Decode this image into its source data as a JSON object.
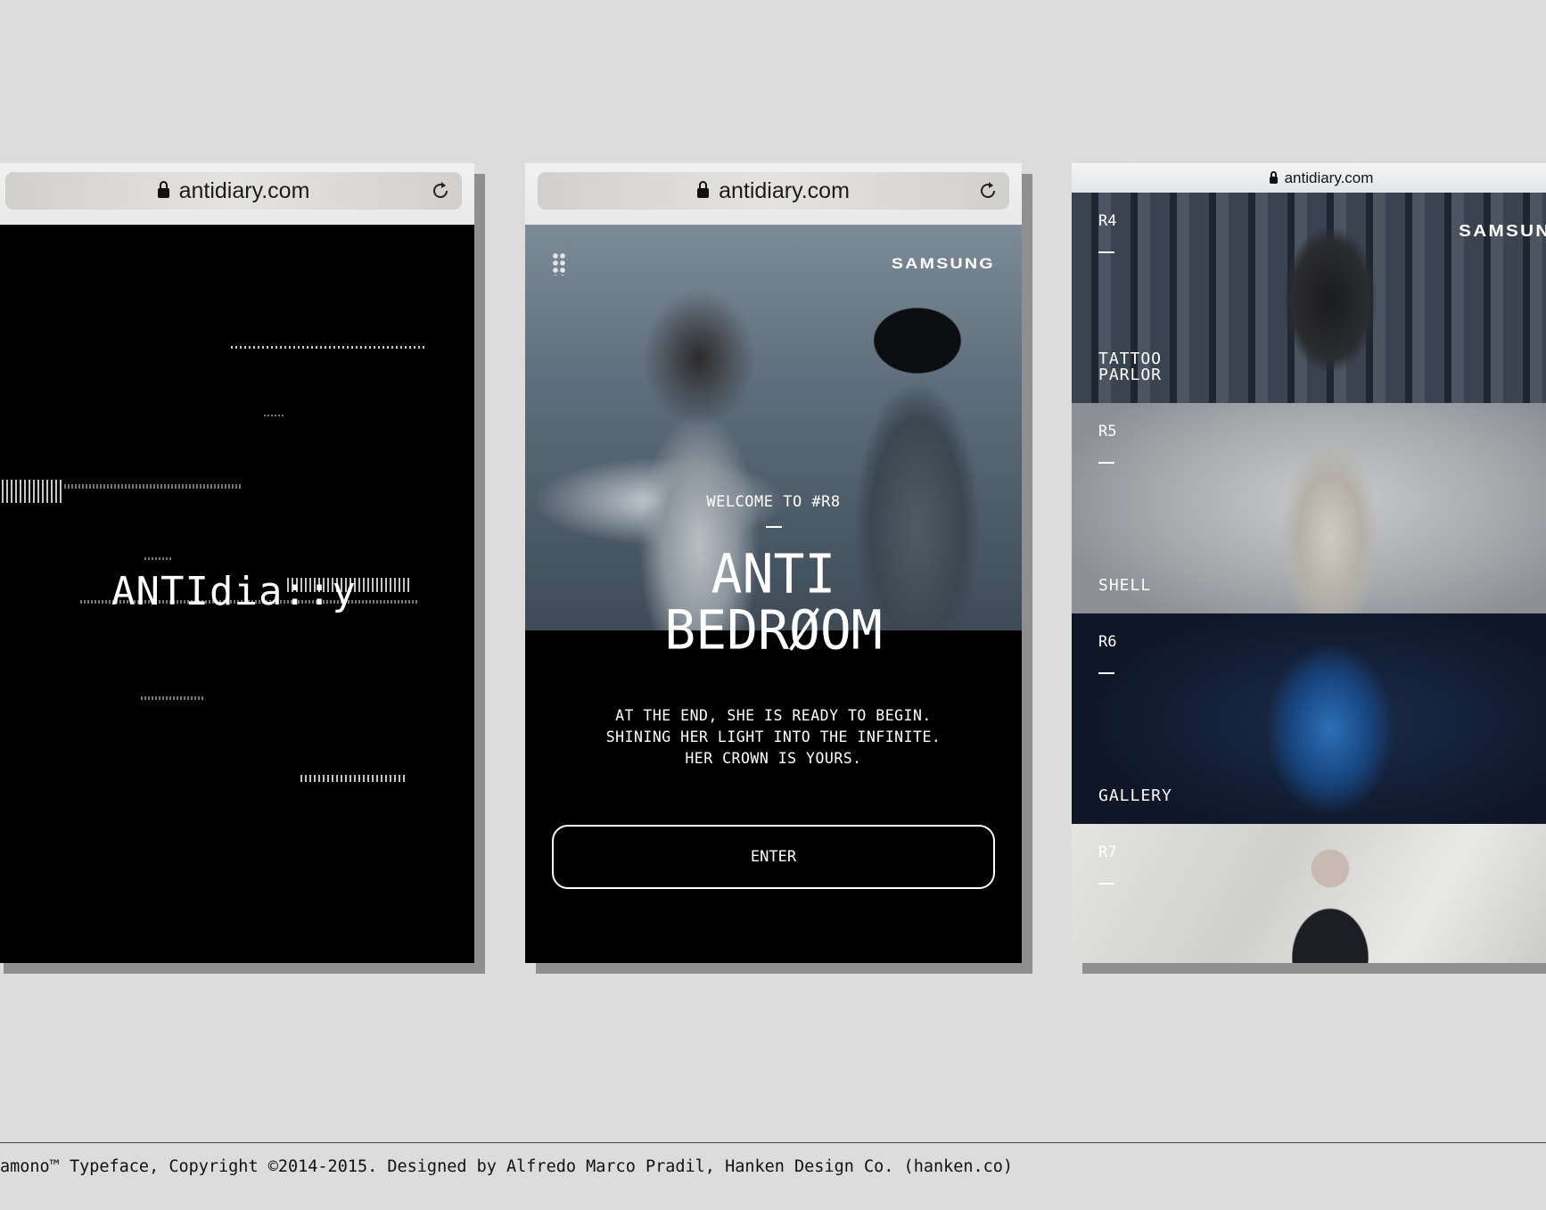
{
  "phone1": {
    "url": "antidiary.com",
    "logo": "ANTIdia::y"
  },
  "phone2": {
    "url": "antidiary.com",
    "brand": "SAMSUNG",
    "welcome": "WELCOME TO #R8",
    "title_line1": "ANTI",
    "title_line2": "BEDRØOM",
    "body_line1": "AT THE END, SHE IS READY TO BEGIN.",
    "body_line2": "SHINING HER LIGHT INTO THE INFINITE.",
    "body_line3": "HER CROWN IS YOURS.",
    "enter": "ENTER"
  },
  "phone3": {
    "url": "antidiary.com",
    "brand": "SAMSUNG",
    "rooms": [
      {
        "code": "R4",
        "name": "TATTOO\nPARLOR"
      },
      {
        "code": "R5",
        "name": "SHELL"
      },
      {
        "code": "R6",
        "name": "GALLERY"
      },
      {
        "code": "R7",
        "name": ""
      }
    ]
  },
  "footer": "amono™ Typeface, Copyright ©2014-2015. Designed by Alfredo Marco Pradil, Hanken Design Co. (hanken.co)"
}
